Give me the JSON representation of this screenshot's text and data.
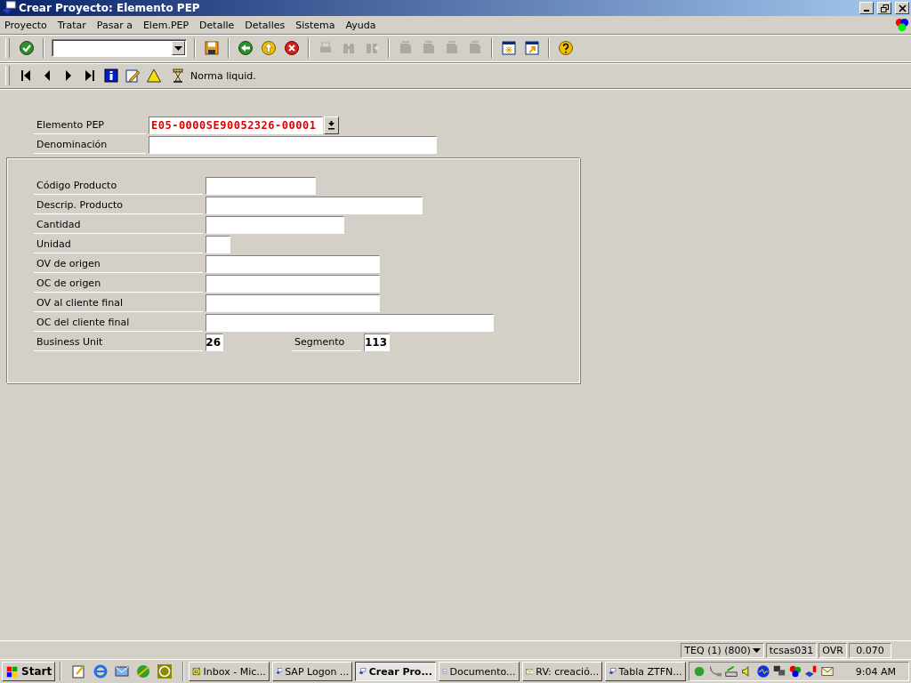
{
  "window": {
    "title": "Crear Proyecto: Elemento PEP"
  },
  "menu": [
    "Proyecto",
    "Tratar",
    "Pasar a",
    "Elem.PEP",
    "Detalle",
    "Detalles",
    "Sistema",
    "Ayuda"
  ],
  "toolbar": [
    {
      "kind": "enter",
      "disabled": false
    },
    {
      "kind": "command"
    },
    {
      "kind": "save",
      "disabled": false
    },
    {
      "kind": "back",
      "disabled": false
    },
    {
      "kind": "exit",
      "disabled": false
    },
    {
      "kind": "cancel",
      "disabled": false
    },
    {
      "kind": "print",
      "disabled": true
    },
    {
      "kind": "find",
      "disabled": true
    },
    {
      "kind": "findnext",
      "disabled": true
    },
    {
      "kind": "first",
      "disabled": true
    },
    {
      "kind": "prev",
      "disabled": true
    },
    {
      "kind": "next",
      "disabled": true
    },
    {
      "kind": "last",
      "disabled": true
    },
    {
      "kind": "session",
      "disabled": false
    },
    {
      "kind": "shortcut",
      "disabled": false
    },
    {
      "kind": "help",
      "disabled": false
    }
  ],
  "app_toolbar": {
    "button_text": "Norma liquid."
  },
  "header_fields": [
    {
      "label": "Elemento PEP",
      "value": "E05-0000SE90052326-00001",
      "highlighted": true,
      "has_dropdown": true
    },
    {
      "label": "Denominación",
      "has_dropdown": false
    }
  ],
  "group_fields": [
    {
      "label": "Código Producto"
    },
    {
      "label": "Descrip. Producto"
    },
    {
      "label": "Cantidad"
    },
    {
      "label": "Unidad"
    },
    {
      "label": "OV de origen"
    },
    {
      "label": "OC de origen"
    },
    {
      "label": "OV al cliente final"
    },
    {
      "label": "OC del cliente final"
    },
    {
      "label": "Business Unit",
      "value": "26",
      "extra": {
        "label": "Segmento",
        "value": "113"
      }
    }
  ],
  "status_bar": {
    "system": "TEQ (1) (800)",
    "server": "tcsas031",
    "mode": "OVR",
    "response_time": "0.070"
  },
  "taskbar": {
    "start": "Start",
    "tasks": [
      {
        "label": "Inbox - Mic...",
        "kind": "clock",
        "selected": false
      },
      {
        "label": "SAP Logon ...",
        "kind": "sap",
        "selected": false
      },
      {
        "label": "Crear Pro...",
        "kind": "sap",
        "selected": true
      },
      {
        "label": "Documento...",
        "kind": "word",
        "selected": false
      },
      {
        "label": "RV: creació...",
        "kind": "mail",
        "selected": false
      },
      {
        "label": "Tabla ZTFN...",
        "kind": "sap",
        "selected": false
      }
    ],
    "clock": "9:04 AM"
  }
}
